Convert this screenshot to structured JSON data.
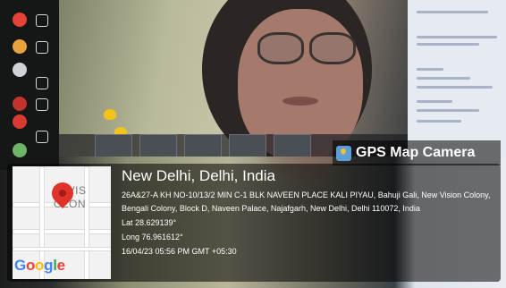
{
  "badge": {
    "icon": "gps-map-camera-icon",
    "title": "GPS Map Camera"
  },
  "location": {
    "city": "New Delhi, Delhi, India",
    "address": "26A&27-A KH NO-10/13/2 MIN C-1 BLK NAVEEN PLACE KALI PIYAU, Bahuji Gali, New Vision Colony, Bengali Colony, Block D, Naveen Palace, Najafgarh, New Delhi, Delhi 110072, India",
    "lat": "Lat 28.629139°",
    "long": "Long 76.961612°",
    "timestamp": "16/04/23 05:56 PM GMT +05:30"
  },
  "map": {
    "label_line1": "W VIS",
    "label_line2": "OLON",
    "logo_letters": [
      "G",
      "o",
      "o",
      "g",
      "l",
      "e"
    ],
    "logo_colors": [
      "#4285f4",
      "#ea4335",
      "#fbbc05",
      "#4285f4",
      "#34a853",
      "#ea4335"
    ]
  }
}
